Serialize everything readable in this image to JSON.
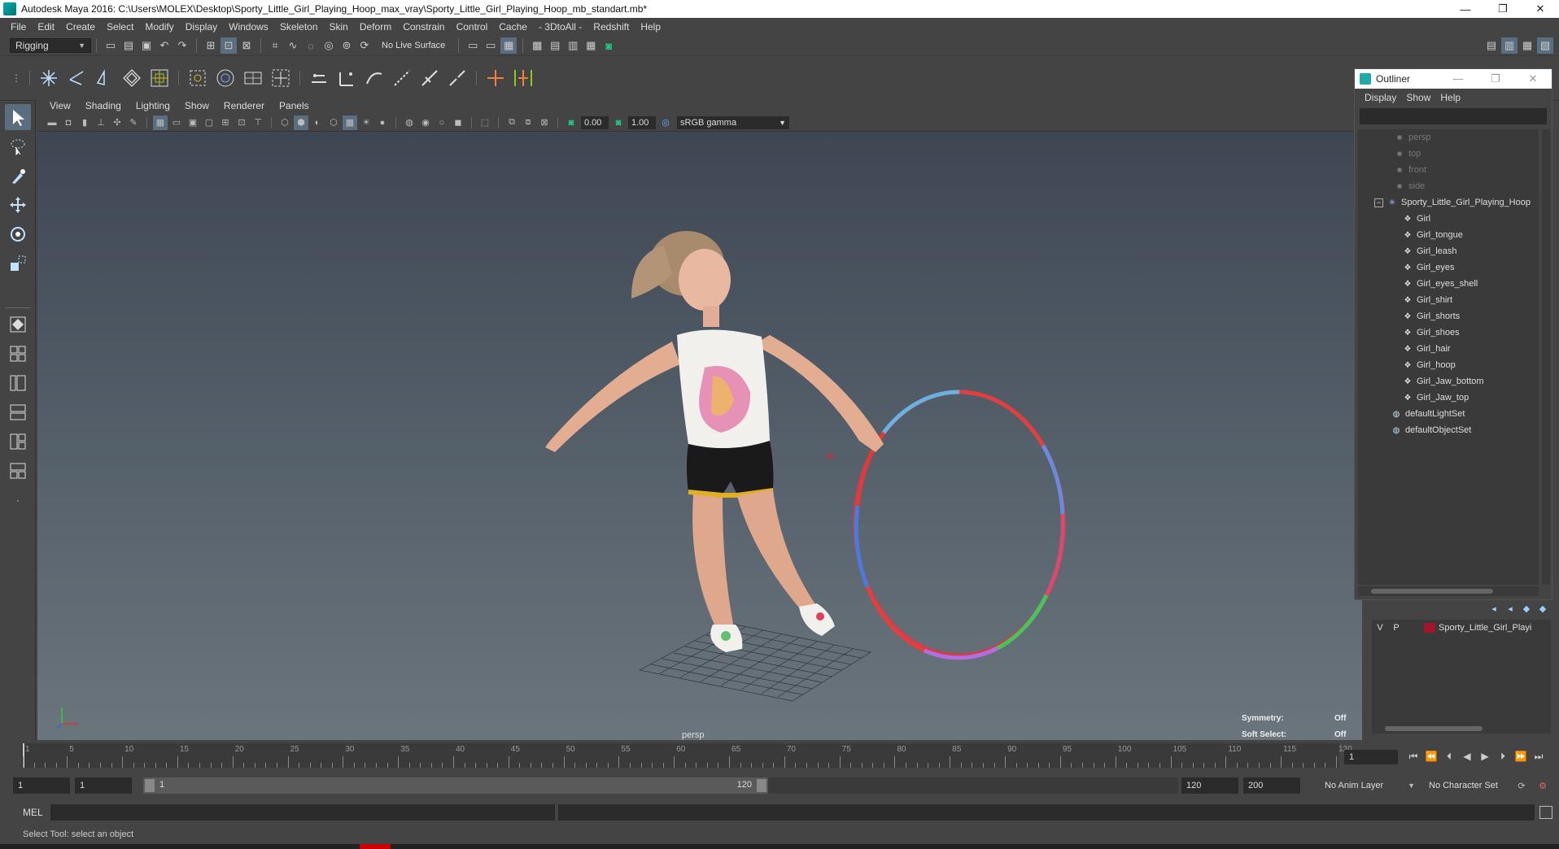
{
  "window": {
    "title": "Autodesk Maya 2016: C:\\Users\\MOLEX\\Desktop\\Sporty_Little_Girl_Playing_Hoop_max_vray\\Sporty_Little_Girl_Playing_Hoop_mb_standart.mb*",
    "minimize": "—",
    "maximize": "❐",
    "close": "✕"
  },
  "menubar": [
    "File",
    "Edit",
    "Create",
    "Select",
    "Modify",
    "Display",
    "Windows",
    "Skeleton",
    "Skin",
    "Deform",
    "Constrain",
    "Control",
    "Cache",
    "- 3DtoAll -",
    "Redshift",
    "Help"
  ],
  "statusline": {
    "menuset": "Rigging",
    "live_surface": "No Live Surface"
  },
  "viewport": {
    "menu": [
      "View",
      "Shading",
      "Lighting",
      "Show",
      "Renderer",
      "Panels"
    ],
    "exposure": "0.00",
    "gamma": "1.00",
    "color_space": "sRGB gamma",
    "camera": "persp",
    "symmetry_label": "Symmetry:",
    "symmetry_value": "Off",
    "soft_select_label": "Soft Select:",
    "soft_select_value": "Off"
  },
  "outliner": {
    "title": "Outliner",
    "menu": [
      "Display",
      "Show",
      "Help"
    ],
    "cameras": [
      "persp",
      "top",
      "front",
      "side"
    ],
    "root": "Sporty_Little_Girl_Playing_Hoop",
    "children": [
      "Girl",
      "Girl_tongue",
      "Girl_leash",
      "Girl_eyes",
      "Girl_eyes_shell",
      "Girl_shirt",
      "Girl_shorts",
      "Girl_shoes",
      "Girl_hair",
      "Girl_hoop",
      "Girl_Jaw_bottom",
      "Girl_Jaw_top"
    ],
    "sets": [
      "defaultLightSet",
      "defaultObjectSet"
    ]
  },
  "layer_editor": {
    "visible": "V",
    "playback": "P",
    "layer_name": "Sporty_Little_Girl_Playi",
    "layer_color": "#a0162a"
  },
  "timeslider": {
    "ticks": [
      "1",
      "5",
      "10",
      "15",
      "20",
      "25",
      "30",
      "35",
      "40",
      "45",
      "50",
      "55",
      "60",
      "65",
      "70",
      "75",
      "80",
      "85",
      "90",
      "95",
      "100",
      "105",
      "110",
      "115",
      "120"
    ],
    "current_frame": "1"
  },
  "rangeslider": {
    "start_time": "1",
    "playback_start": "1",
    "range_start": "1",
    "range_end": "120",
    "playback_end": "120",
    "end_time": "200",
    "anim_layer": "No Anim Layer",
    "character_set": "No Character Set"
  },
  "cmdline": {
    "label": "MEL"
  },
  "helpline": {
    "text": "Select Tool: select an object"
  }
}
